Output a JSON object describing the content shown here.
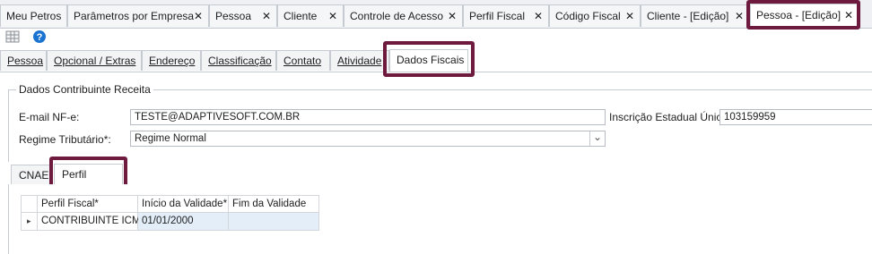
{
  "doc_tabs": [
    {
      "label": "Meu Petros"
    },
    {
      "label": "Parâmetros por Empresa"
    },
    {
      "label": "Pessoa"
    },
    {
      "label": "Cliente"
    },
    {
      "label": "Controle de Acesso"
    },
    {
      "label": "Perfil Fiscal"
    },
    {
      "label": "Código Fiscal"
    },
    {
      "label": "Cliente - [Edição]"
    },
    {
      "label": "Pessoa - [Edição]"
    }
  ],
  "close_glyph": "✕",
  "toolbar": {
    "grid_icon": "grid-icon",
    "help_icon": "help-icon",
    "help_glyph": "?"
  },
  "sub_tabs": [
    {
      "label": "Pessoa"
    },
    {
      "label": "Opcional / Extras"
    },
    {
      "label": "Endereço"
    },
    {
      "label": "Classificação"
    },
    {
      "label": "Contato"
    },
    {
      "label": "Atividade"
    },
    {
      "label": "Dados Fiscais"
    }
  ],
  "group": {
    "title": "Dados Contribuinte Receita",
    "email_label": "E-mail NF-e:",
    "email_value": "TESTE@ADAPTIVESOFT.COM.BR",
    "ie_label": "Inscrição Estadual Única:",
    "ie_value": "103159959",
    "regime_label": "Regime Tributário*:",
    "regime_value": "Regime Normal",
    "dropdown_glyph": "⌄"
  },
  "inner_tabs": [
    {
      "label": "CNAE"
    },
    {
      "label": "Perfil Fiscal"
    }
  ],
  "grid": {
    "columns": [
      "Perfil Fiscal*",
      "Início da Validade*",
      "Fim da Validade"
    ],
    "rows": [
      {
        "indicator": "▸",
        "cells": [
          "CONTRIBUINTE ICMS",
          "01/01/2000",
          ""
        ]
      }
    ]
  },
  "colors": {
    "highlight": "#6e1a3f",
    "selection": "#e3eef9",
    "help": "#1b73d1"
  }
}
